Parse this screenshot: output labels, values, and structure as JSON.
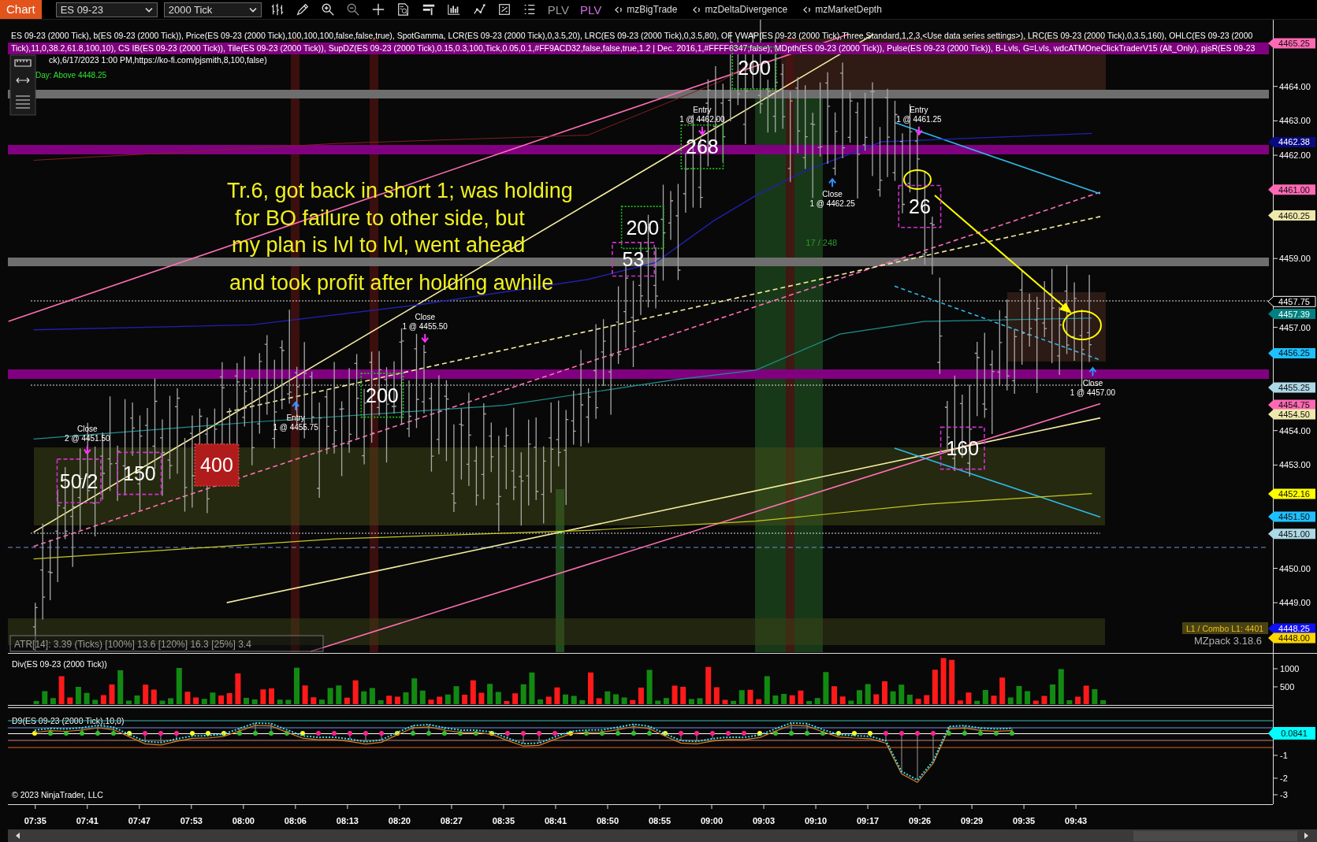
{
  "toolbar": {
    "title": "Chart",
    "instrument": "ES 09-23",
    "interval": "2000 Tick",
    "plv_buttons": [
      {
        "label": "PLV",
        "active": false
      },
      {
        "label": "PLV",
        "active": true
      }
    ],
    "indicator_buttons": [
      "mzBigTrade",
      "mzDeltaDivergence",
      "mzMarketDepth"
    ]
  },
  "main_panel": {
    "indicator_legend": [
      "ES 09-23 (2000 Tick), b(ES 09-23 (2000 Tick)), Price(ES 09-23 (2000 Tick),100,100,100,false,false,true), SpotGamma, LCR(ES 09-23 (2000 Tick),0,3.5,20), LRC(ES 09-23 (2000 Tick),0,3.5,80), OF VWAP(ES 09-23 (2000 Tick),Three,Standard,1,2,3,<Use data series settings>), LRC(ES 09-23 (2000 Tick),0,3.5,160), OHLC(ES 09-23 (2000",
      "Tick),11,0,38.2,61.8,100,10), CS IB(ES 09-23 (2000 Tick)), Tile(ES 09-23 (2000 Tick)), SupDZ(ES 09-23 (2000 Tick),0.15,0.3,100,Tick,0.05,0.1,#FF9ACD32,false,false,true,1.2 | Dec. 2016,1,#FFFF6347,false), MDpth(ES 09-23 (2000 Tick)), Pulse(ES 09-23 (2000 Tick)), B-Lvls, G=Lvls, wdcATMOneClickTraderV15 (Alt_Only), pjsR(ES 09-23",
      "ck),6/17/2023 1:00 PM,https://ko-fi.com/pjsmith,8,100,false)"
    ],
    "day_note": "Day: Above 4448.25",
    "annotation_lines": [
      "Tr.6, got back in short 1; was holding",
      " for BO failure to other side, but",
      " my plan is lvl to lvl, went ahead",
      "and took profit after holding awhile"
    ],
    "trade_markers": [
      {
        "action": "Close",
        "detail": "2 @ 4451.50",
        "kind": "down"
      },
      {
        "action": "Entry",
        "detail": "1 @ 4455.75",
        "kind": "up"
      },
      {
        "action": "Close",
        "detail": "1 @ 4455.50",
        "kind": "down"
      },
      {
        "action": "Entry",
        "detail": "1 @ 4462.00",
        "kind": "down"
      },
      {
        "action": "Close",
        "detail": "1 @ 4462.25",
        "kind": "up"
      },
      {
        "action": "Entry",
        "detail": "1 @ 4461.25",
        "kind": "down"
      },
      {
        "action": "Close",
        "detail": "1 @ 4457.00",
        "kind": "up"
      }
    ],
    "volume_boxes": [
      {
        "label": "50/2",
        "kind": "sell"
      },
      {
        "label": "150",
        "kind": "sell"
      },
      {
        "label": "400",
        "kind": "large"
      },
      {
        "label": "200",
        "kind": "buy"
      },
      {
        "label": "200",
        "kind": "buy"
      },
      {
        "label": "53",
        "kind": "sell"
      },
      {
        "label": "268",
        "kind": "buy"
      },
      {
        "label": "200",
        "kind": "buy"
      },
      {
        "label": "26",
        "kind": "sell"
      },
      {
        "label": "160",
        "kind": "sell"
      }
    ],
    "ratio_label": "17 / 248",
    "atr_text": "ATR[14]: 3.39 (Ticks) [100%] 13.6  [120%] 16.3  [25%] 3.4",
    "level_label": "L1 / Combo L1: 4401",
    "version_label": "MZpack 3.18.6",
    "price_ticks": [
      "4464.00",
      "4463.00",
      "4462.00",
      "4459.00",
      "4457.00",
      "4454.00",
      "4453.00",
      "4450.00",
      "4449.00"
    ],
    "price_tags": [
      {
        "text": "4465.25",
        "color": "#ff69b4"
      },
      {
        "text": "4462.38",
        "color": "#0a0a80"
      },
      {
        "text": "4461.00",
        "color": "#ff69b4"
      },
      {
        "text": "4460.25",
        "color": "#eee8aa"
      },
      {
        "text": "4457.75",
        "color": "#000000"
      },
      {
        "text": "4457.39",
        "color": "#008080"
      },
      {
        "text": "4456.25",
        "color": "#1ec0ff"
      },
      {
        "text": "4455.25",
        "color": "#add8e6"
      },
      {
        "text": "4454.75",
        "color": "#ff69b4"
      },
      {
        "text": "4454.50",
        "color": "#eee8aa"
      },
      {
        "text": "4452.16",
        "color": "#ffff00"
      },
      {
        "text": "4451.50",
        "color": "#1ec0ff"
      },
      {
        "text": "4451.00",
        "color": "#add8e6"
      },
      {
        "text": "4448.25",
        "color": "#1010f0"
      },
      {
        "text": "4448.00",
        "color": "#ffd700"
      }
    ]
  },
  "div_panel": {
    "title": "Div(ES 09-23 (2000 Tick))",
    "ticks": [
      "1000",
      "500"
    ]
  },
  "d9_panel": {
    "title": "D9(ES 09-23 (2000 Tick),10,0)",
    "value_tag": {
      "text": "0.0841",
      "color": "#00ffff"
    },
    "ticks": [
      "-1",
      "-2",
      "-3"
    ]
  },
  "copyright": "© 2023 NinjaTrader, LLC",
  "time_axis": [
    "07:35",
    "07:41",
    "07:47",
    "07:53",
    "08:00",
    "08:06",
    "08:13",
    "08:20",
    "08:27",
    "08:35",
    "08:41",
    "08:50",
    "08:55",
    "09:00",
    "09:03",
    "09:10",
    "09:17",
    "09:26",
    "09:29",
    "09:35",
    "09:43"
  ]
}
